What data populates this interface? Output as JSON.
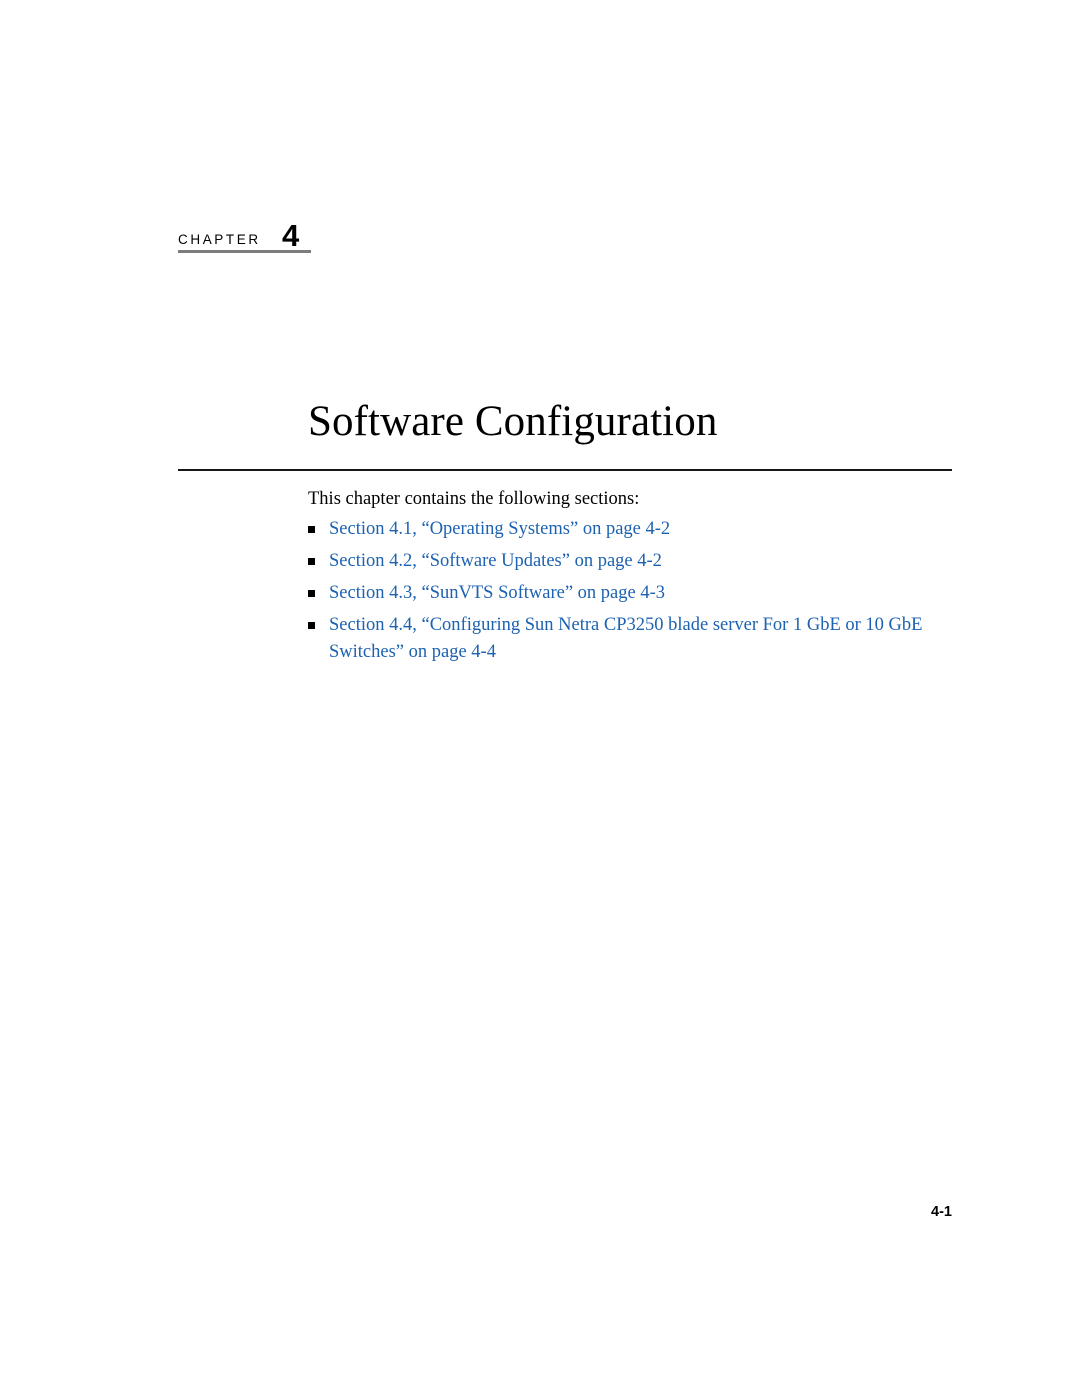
{
  "document": {
    "chapter_label": "CHAPTER",
    "chapter_number": "4",
    "title": "Software Configuration",
    "intro": "This chapter contains the following sections:",
    "page_number": "4-1"
  },
  "colors": {
    "link": "#1c62b0",
    "rule": "#17171a",
    "chapter_rule": "#7d7d7d",
    "text": "#000000",
    "background": "#ffffff"
  },
  "sections": [
    {
      "label": "Section 4.1, “Operating Systems” on page 4-2"
    },
    {
      "label": "Section 4.2, “Software Updates” on page 4-2"
    },
    {
      "label": "Section 4.3, “SunVTS Software” on page 4-3"
    },
    {
      "label": "Section 4.4, “Configuring Sun Netra CP3250 blade server For 1 GbE or 10 GbE Switches” on page 4-4"
    }
  ]
}
